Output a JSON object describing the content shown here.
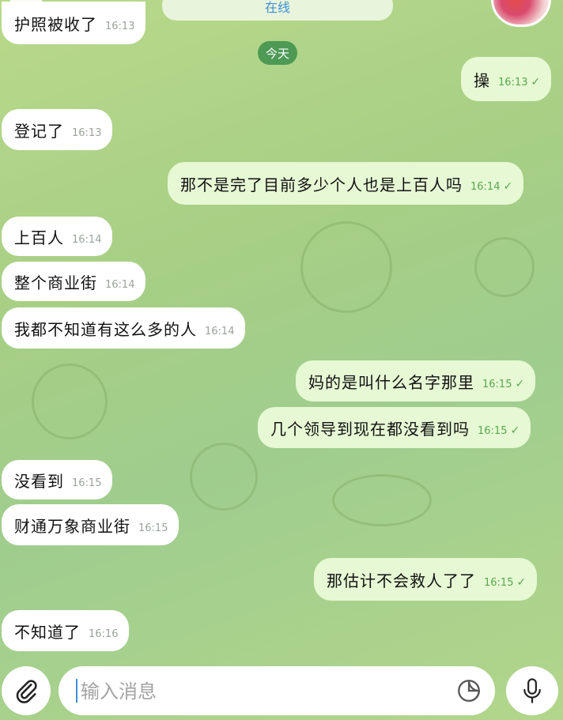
{
  "header": {
    "status": "在线"
  },
  "date_divider": "今天",
  "messages": [
    {
      "text": "护照被收了",
      "time": "16:13",
      "dir": "in"
    },
    {
      "text": "操",
      "time": "16:13",
      "dir": "out"
    },
    {
      "text": "登记了",
      "time": "16:13",
      "dir": "in"
    },
    {
      "text": "那不是完了目前多少个人也是上百人吗",
      "time": "16:14",
      "dir": "out"
    },
    {
      "text": "上百人",
      "time": "16:14",
      "dir": "in"
    },
    {
      "text": "整个商业街",
      "time": "16:14",
      "dir": "in"
    },
    {
      "text": "我都不知道有这么多的人",
      "time": "16:14",
      "dir": "in"
    },
    {
      "text": "妈的是叫什么名字那里",
      "time": "16:15",
      "dir": "out"
    },
    {
      "text": "几个领导到现在都没看到吗",
      "time": "16:15",
      "dir": "out"
    },
    {
      "text": "没看到",
      "time": "16:15",
      "dir": "in"
    },
    {
      "text": "财通万象商业街",
      "time": "16:15",
      "dir": "in"
    },
    {
      "text": "那估计不会救人了了",
      "time": "16:15",
      "dir": "out"
    },
    {
      "text": "不知道了",
      "time": "16:16",
      "dir": "in"
    }
  ],
  "composer": {
    "placeholder": "输入消息"
  },
  "icons": {
    "attach": "paperclip-icon",
    "sticker": "sticker-icon",
    "mic": "microphone-icon",
    "read_receipt": "check-icon"
  },
  "colors": {
    "incoming_bubble": "#ffffff",
    "outgoing_bubble": "#e6f8d4",
    "date_chip": "#4e9a55",
    "status_text": "#3b8fd6",
    "outgoing_time": "#5aa84e"
  }
}
